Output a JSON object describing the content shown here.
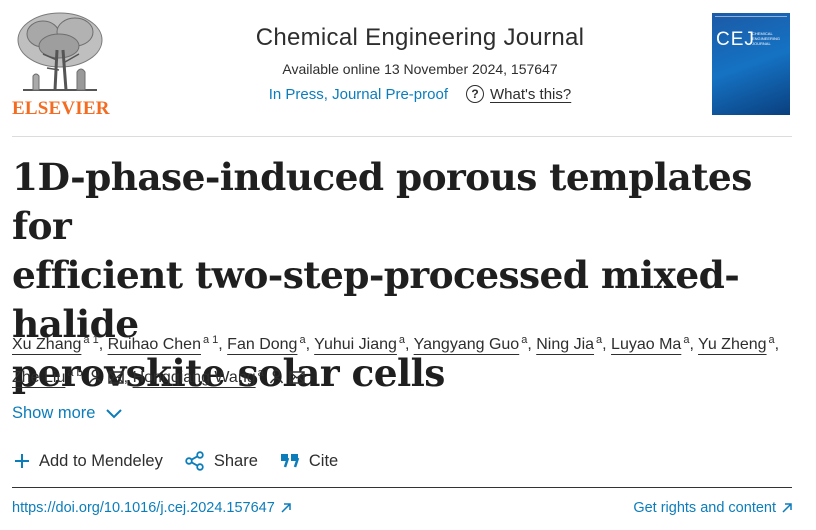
{
  "publisher": {
    "name": "ELSEVIER"
  },
  "journal": {
    "title": "Chemical Engineering Journal",
    "availability": "Available online 13 November 2024, 157647",
    "status_link": "In Press, Journal Pre-proof",
    "help_label": "What's this?",
    "cover_abbr": "CEJ",
    "cover_name": "CHEMICAL ENGINEERING JOURNAL"
  },
  "article": {
    "title_lines": [
      "1D-phase-induced porous templates for",
      "efficient two-step-processed mixed-halide",
      "perovskite solar cells"
    ]
  },
  "authors": [
    {
      "name": "Xu Zhang",
      "affil": "a 1"
    },
    {
      "name": "Ruihao Chen",
      "affil": "a 1"
    },
    {
      "name": "Fan Dong",
      "affil": "a"
    },
    {
      "name": "Yuhui Jiang",
      "affil": "a"
    },
    {
      "name": "Yangyang Guo",
      "affil": "a"
    },
    {
      "name": "Ning Jia",
      "affil": "a"
    },
    {
      "name": "Luyao Ma",
      "affil": "a"
    },
    {
      "name": "Yu Zheng",
      "affil": "a"
    },
    {
      "name": "Zhe Liu",
      "affil": "a b",
      "icons": [
        "person-icon",
        "email-icon"
      ]
    },
    {
      "name": "Hongqiang Wang",
      "affil": "a",
      "icons": [
        "person-icon",
        "email-icon"
      ]
    }
  ],
  "show_more": "Show more",
  "actions": {
    "mendeley": "Add to Mendeley",
    "share": "Share",
    "cite": "Cite"
  },
  "footer": {
    "doi": "https://doi.org/10.1016/j.cej.2024.157647",
    "rights": "Get rights and content"
  },
  "colors": {
    "link": "#0c7dbb",
    "brand": "#f36c21",
    "text": "#2e2e2e"
  }
}
